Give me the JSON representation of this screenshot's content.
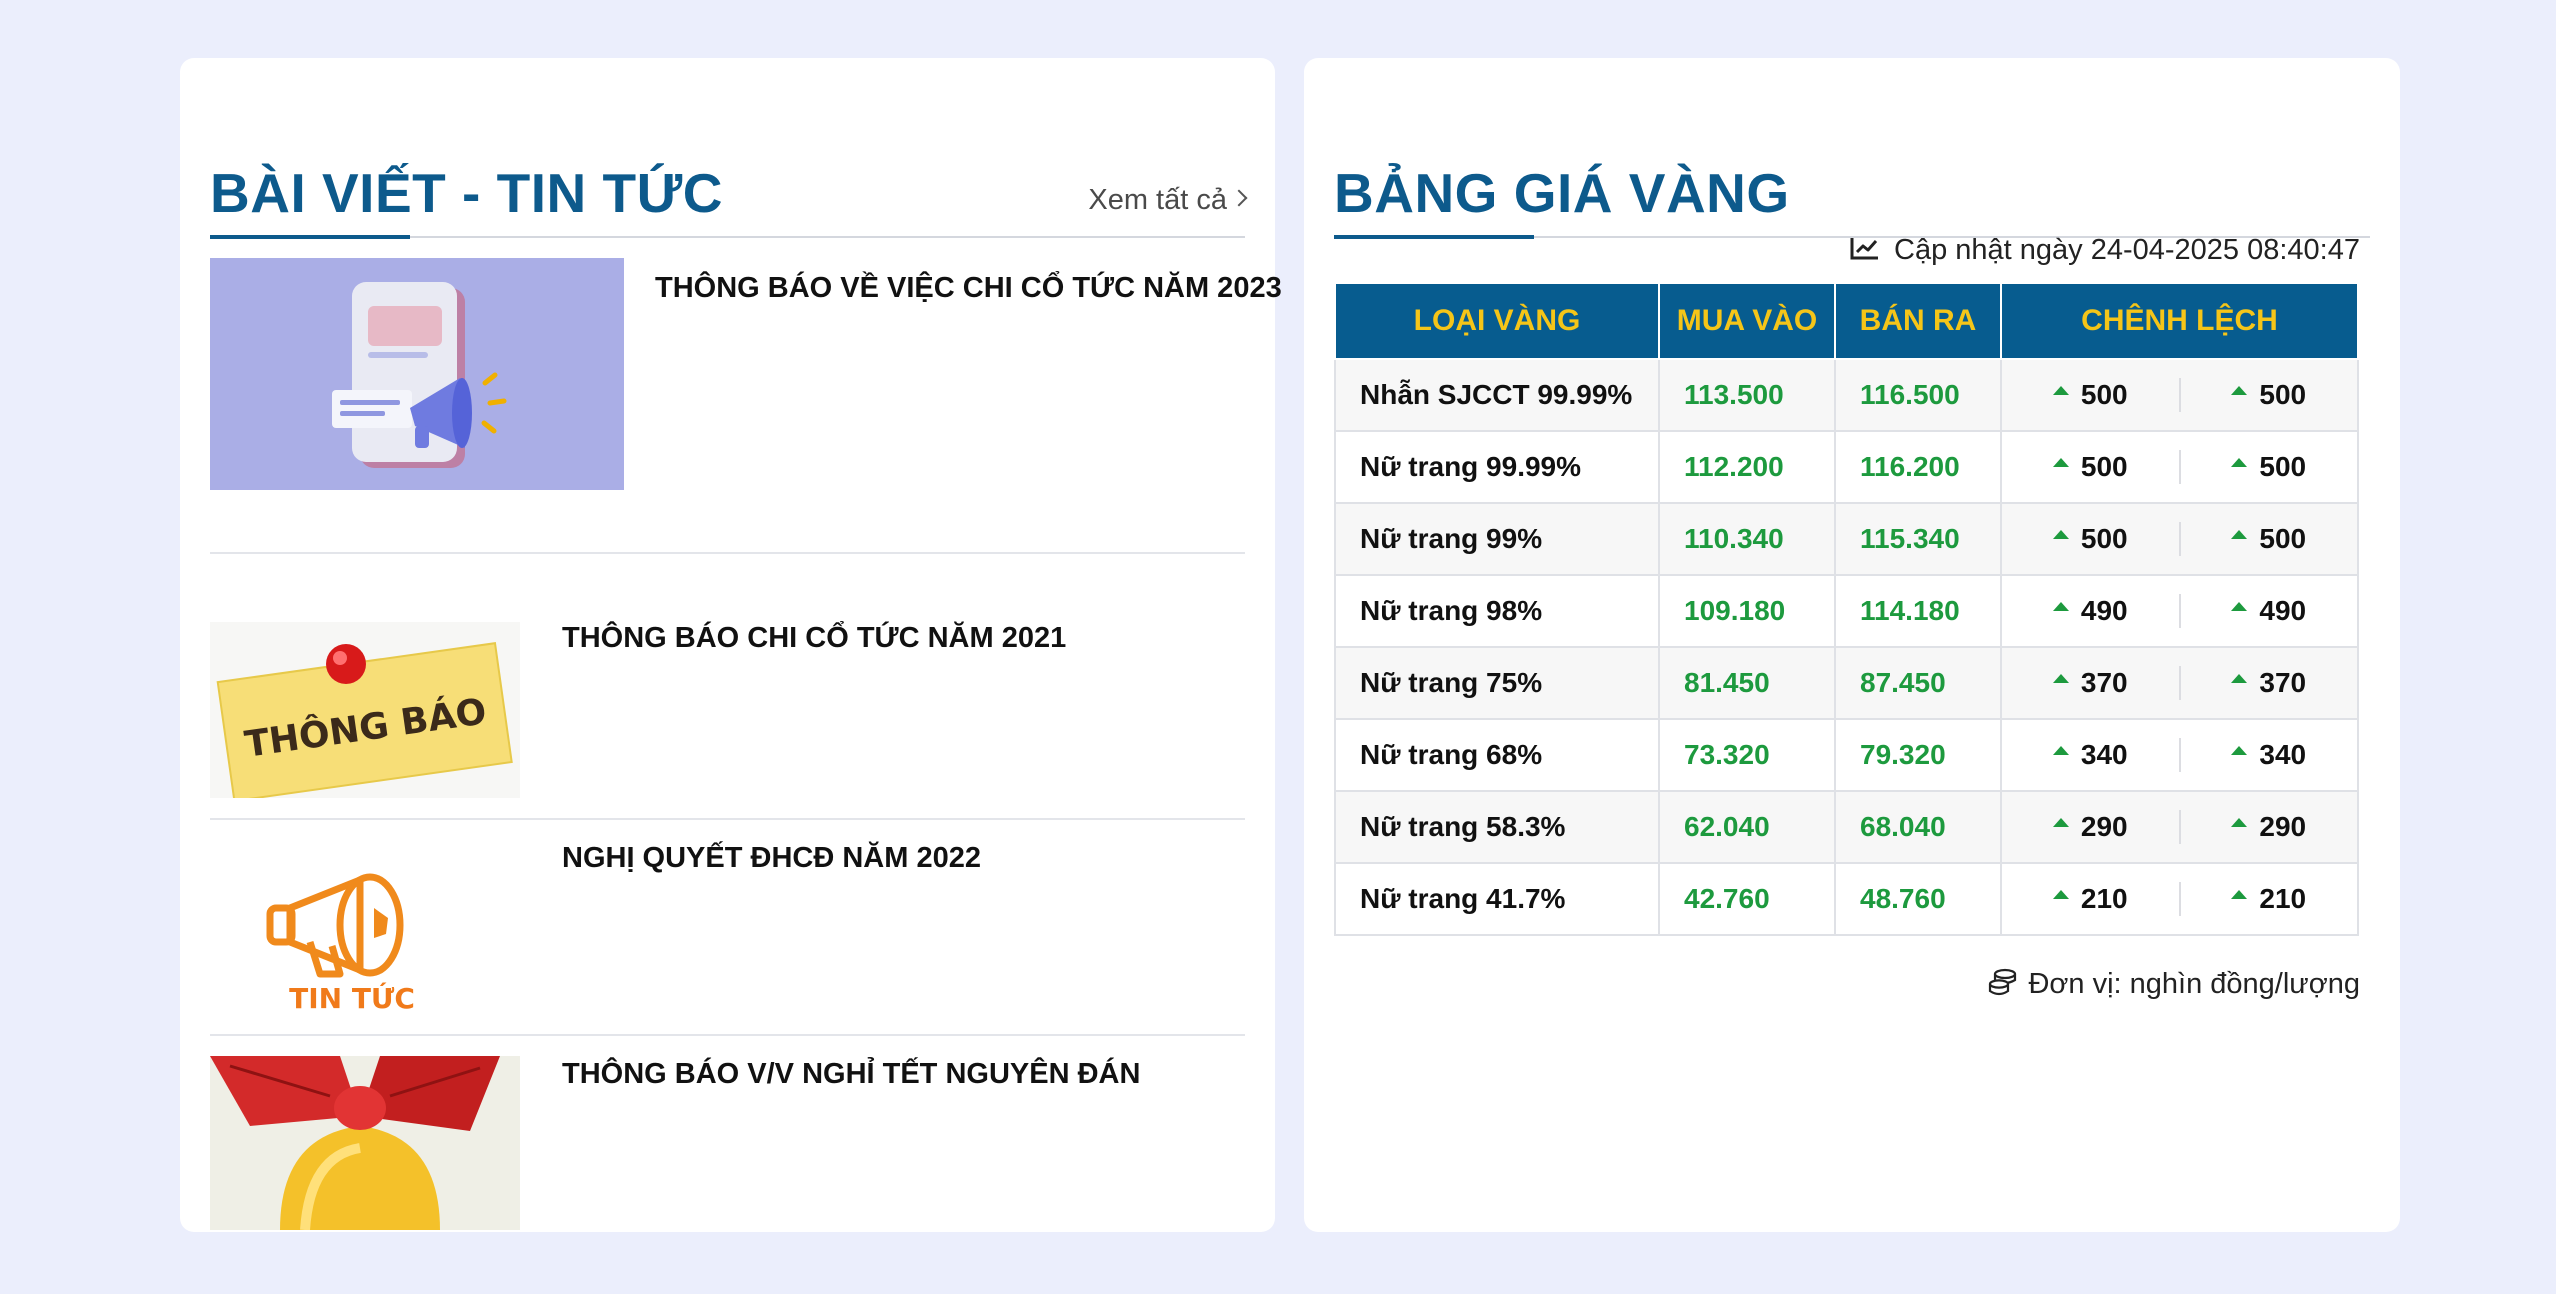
{
  "news": {
    "title": "BÀI VIẾT - TIN TỨC",
    "see_all": "Xem tất cả",
    "items": [
      {
        "title": "THÔNG BÁO VỀ VIỆC CHI CỔ TỨC NĂM 2023",
        "thumb": "megaphone-phone-illustration"
      },
      {
        "title": "THÔNG BÁO CHI CỔ TỨC NĂM 2021",
        "thumb": "pinned-notice-thong-bao",
        "thumb_text": "THÔNG BÁO"
      },
      {
        "title": "NGHỊ QUYẾT ĐHCĐ NĂM 2022",
        "thumb": "megaphone-tin-tuc",
        "thumb_text": "TIN TỨC"
      },
      {
        "title": "THÔNG BÁO V/V NGHỈ TẾT NGUYÊN ĐÁN",
        "thumb": "yellow-bell-red-ribbon"
      }
    ]
  },
  "gold": {
    "title": "BẢNG GIÁ VÀNG",
    "updated": "Cập nhật ngày 24-04-2025 08:40:47",
    "headers": [
      "LOẠI VÀNG",
      "MUA VÀO",
      "BÁN RA",
      "CHÊNH LỆCH"
    ],
    "rows": [
      {
        "type": "Nhẫn SJCCT 99.99%",
        "buy": "113.500",
        "sell": "116.500",
        "diff_buy": "500",
        "diff_sell": "500"
      },
      {
        "type": "Nữ trang 99.99%",
        "buy": "112.200",
        "sell": "116.200",
        "diff_buy": "500",
        "diff_sell": "500"
      },
      {
        "type": "Nữ trang 99%",
        "buy": "110.340",
        "sell": "115.340",
        "diff_buy": "500",
        "diff_sell": "500"
      },
      {
        "type": "Nữ trang 98%",
        "buy": "109.180",
        "sell": "114.180",
        "diff_buy": "490",
        "diff_sell": "490"
      },
      {
        "type": "Nữ trang 75%",
        "buy": "81.450",
        "sell": "87.450",
        "diff_buy": "370",
        "diff_sell": "370"
      },
      {
        "type": "Nữ trang 68%",
        "buy": "73.320",
        "sell": "79.320",
        "diff_buy": "340",
        "diff_sell": "340"
      },
      {
        "type": "Nữ trang 58.3%",
        "buy": "62.040",
        "sell": "68.040",
        "diff_buy": "290",
        "diff_sell": "290"
      },
      {
        "type": "Nữ trang 41.7%",
        "buy": "42.760",
        "sell": "48.760",
        "diff_buy": "210",
        "diff_sell": "210"
      }
    ],
    "unit": "Đơn vị: nghìn đồng/lượng",
    "colors": {
      "header_bg": "#075c8f",
      "header_text": "#f5c518",
      "price": "#1d9a3e",
      "up": "#1d9a3e"
    }
  },
  "colors": {
    "page_bg": "#ebeefc",
    "title": "#0d5a8c"
  }
}
